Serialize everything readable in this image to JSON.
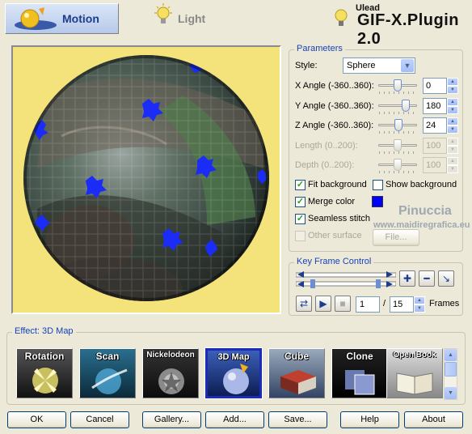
{
  "tabs": [
    {
      "label": "Motion",
      "active": true
    },
    {
      "label": "Light",
      "active": false
    }
  ],
  "brand": {
    "company": "Ulead",
    "product": "GIF-X.Plugin 2.0"
  },
  "parameters": {
    "title": "Parameters",
    "style_label": "Style:",
    "style_value": "Sphere",
    "x_angle": {
      "label": "X Angle (-360..360):",
      "value": "0",
      "slider": 0.5
    },
    "y_angle": {
      "label": "Y Angle (-360..360):",
      "value": "180",
      "slider": 0.75
    },
    "z_angle": {
      "label": "Z Angle (-360..360):",
      "value": "24",
      "slider": 0.53
    },
    "length": {
      "label": "Length (0..200):",
      "value": "100",
      "slider": 0.5,
      "enabled": false
    },
    "depth": {
      "label": "Depth (0..200):",
      "value": "100",
      "slider": 0.5,
      "enabled": false
    },
    "fit_background": {
      "label": "Fit background",
      "checked": true
    },
    "show_background": {
      "label": "Show background",
      "checked": false
    },
    "merge_color": {
      "label": "Merge color",
      "checked": true,
      "color": "#0000ff"
    },
    "seamless_stitch": {
      "label": "Seamless stitch",
      "checked": true
    },
    "other_surface": {
      "label": "Other surface",
      "checked": false,
      "enabled": false
    },
    "file_button": "File..."
  },
  "watermark": {
    "name": "Pinuccia",
    "url": "www.maidiregrafica.eu"
  },
  "keyframe": {
    "title": "Key Frame Control",
    "current_frame": "1",
    "separator": "/",
    "total_frames": "15",
    "frames_label": "Frames"
  },
  "effect": {
    "title": "Effect: 3D Map",
    "items": [
      {
        "label": "Rotation",
        "selected": false
      },
      {
        "label": "Scan",
        "selected": false
      },
      {
        "label": "Nickelodeon",
        "selected": false
      },
      {
        "label": "3D Map",
        "selected": true
      },
      {
        "label": "Cube",
        "selected": false
      },
      {
        "label": "Clone",
        "selected": false
      },
      {
        "label": "Open Book",
        "selected": false
      }
    ]
  },
  "buttons": {
    "ok": "OK",
    "cancel": "Cancel",
    "gallery": "Gallery...",
    "add": "Add...",
    "save": "Save...",
    "help": "Help",
    "about": "About"
  }
}
